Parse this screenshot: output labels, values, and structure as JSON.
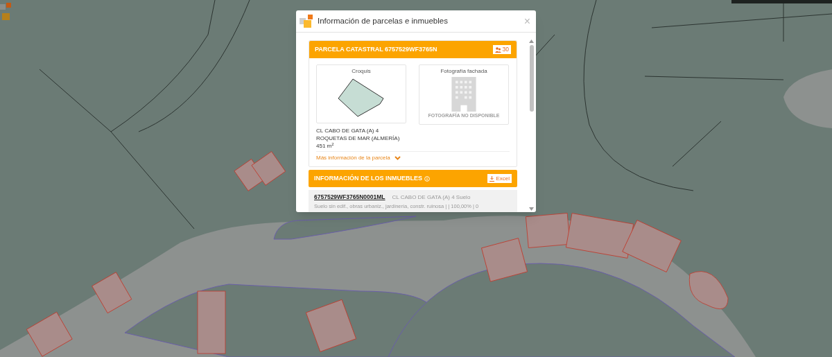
{
  "dialog": {
    "title": "Información de parcelas e inmuebles",
    "close": "×"
  },
  "parcel": {
    "header": "PARCELA CATASTRAL 6757529WF3765N",
    "badge": "30",
    "sketch_label": "Croquis",
    "photo_label": "Fotografía fachada",
    "photo_missing": "FOTOGRAFÍA NO DISPONIBLE",
    "address": [
      "CL CABO DE GATA (A) 4",
      "ROQUETAS DE MAR (ALMERÍA)",
      "451 m$^{2}$"
    ],
    "more_link": "Más información de la parcela",
    "expanded": false
  },
  "properties": {
    "header": "INFORMACIÓN DE LOS INMUEBLES",
    "excel_button": "Excel",
    "items": [
      {
        "reference": "6757529WF3765N0001ML",
        "address": "CL CABO DE GATA (A) 4 Suelo",
        "detail": "Suelo sin edif., obras urbaniz., jardinería, constr. ruinosa | | 100,00% | 0"
      }
    ]
  }
}
